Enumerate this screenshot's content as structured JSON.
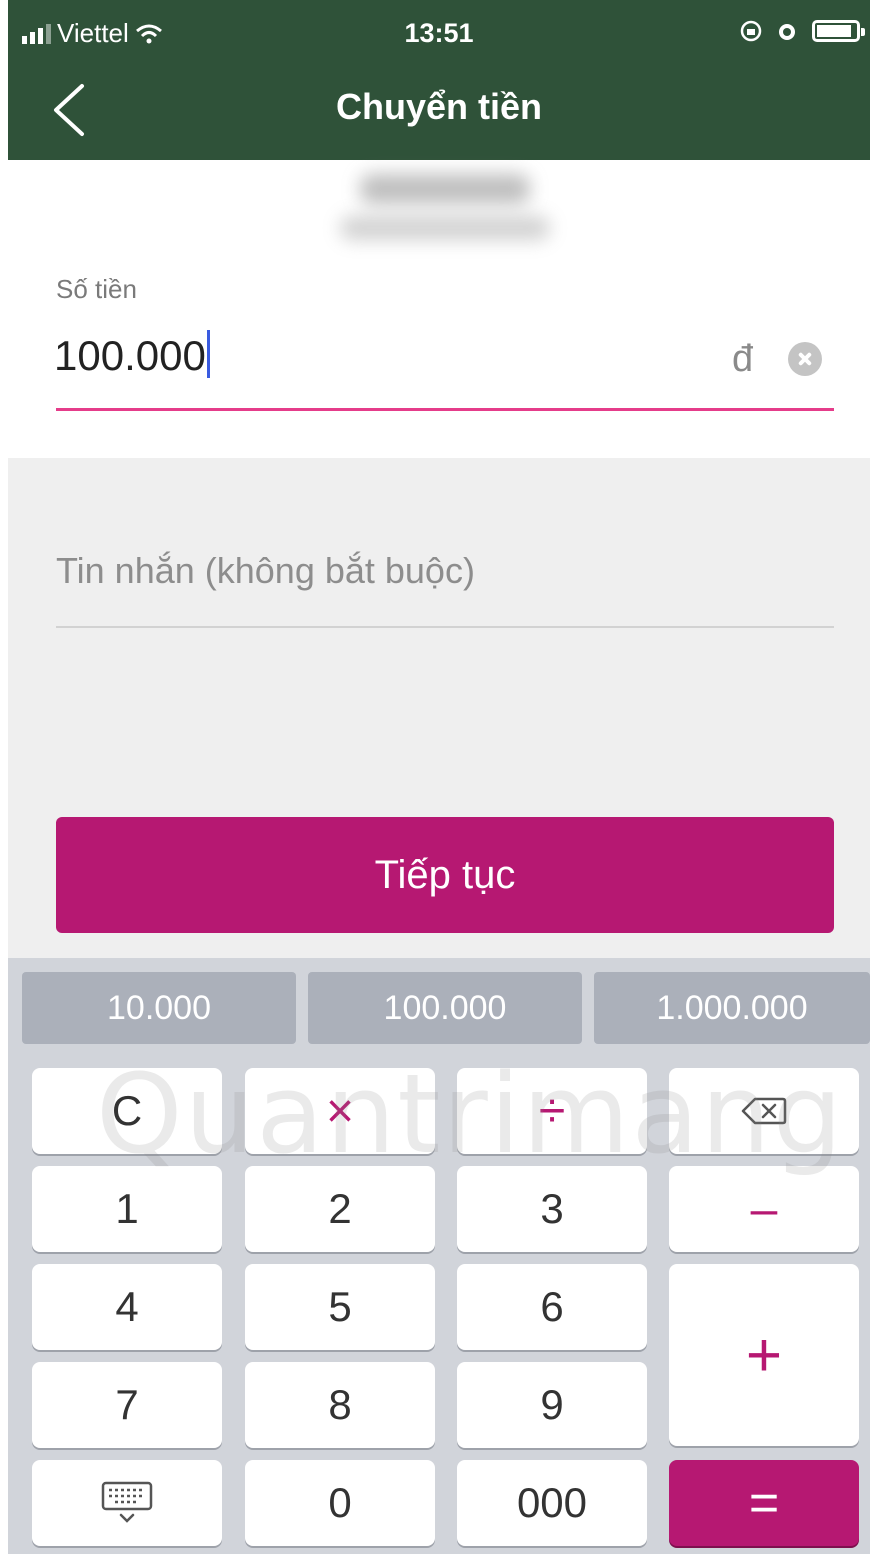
{
  "status_bar": {
    "carrier": "Viettel",
    "time": "13:51"
  },
  "nav": {
    "back_icon": "chevron-left-icon",
    "title": "Chuyển tiền"
  },
  "amount": {
    "label": "Số tiền",
    "value": "100.000",
    "currency": "đ",
    "clear_icon": "clear-circle-icon"
  },
  "message": {
    "placeholder": "Tin nhắn (không bắt buộc)"
  },
  "continue_label": "Tiếp tục",
  "keyboard": {
    "quick_amounts": [
      "10.000",
      "100.000",
      "1.000.000"
    ],
    "keys": {
      "clear": "C",
      "multiply": "×",
      "divide": "÷",
      "backspace_icon": "backspace-icon",
      "k1": "1",
      "k2": "2",
      "k3": "3",
      "minus": "–",
      "k4": "4",
      "k5": "5",
      "k6": "6",
      "plus": "+",
      "k7": "7",
      "k8": "8",
      "k9": "9",
      "keyboard_icon": "keyboard-toggle-icon",
      "k0": "0",
      "k000": "000",
      "equals": "="
    }
  },
  "colors": {
    "header": "#2f5239",
    "accent": "#b61872",
    "underline_active": "#e53c8a"
  },
  "watermark": "Quantrimang"
}
